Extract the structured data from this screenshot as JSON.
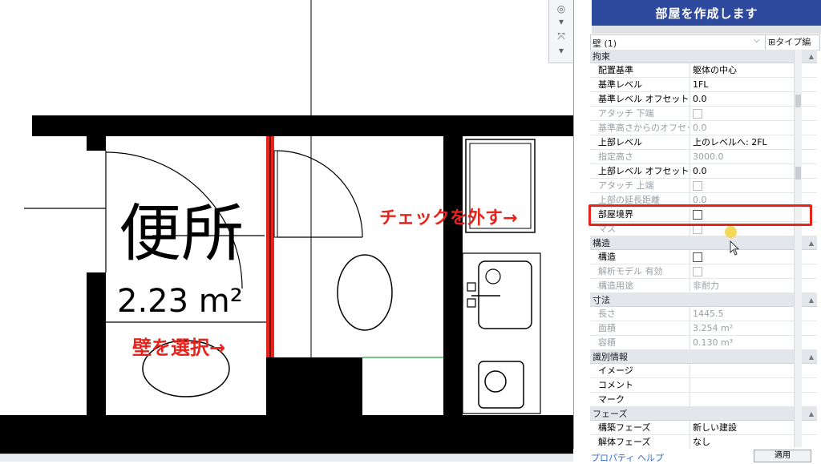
{
  "room": {
    "name": "便所",
    "area": "2.23 m²"
  },
  "annotations": {
    "select_wall": "壁を選択→",
    "uncheck": "チェックを外す→"
  },
  "panel": {
    "banner": "部屋を作成します",
    "type_selector": "壁 (1)",
    "edit_type": "タイプ編集",
    "sections": {
      "constraints": "拘束",
      "structure": "構造",
      "dimensions": "寸法",
      "identity": "識別情報",
      "phasing": "フェーズ"
    },
    "rows": {
      "location_line": {
        "k": "配置基準",
        "v": "躯体の中心"
      },
      "base_level": {
        "k": "基準レベル",
        "v": "1FL"
      },
      "base_offset": {
        "k": "基準レベル オフセット",
        "v": "0.0"
      },
      "attach_bottom": {
        "k": "アタッチ 下端"
      },
      "base_from_offset": {
        "k": "基準高さからのオフセット",
        "v": "0.0"
      },
      "top_level": {
        "k": "上部レベル",
        "v": "上のレベルへ: 2FL"
      },
      "unconnected_height": {
        "k": "指定高さ",
        "v": "3000.0"
      },
      "top_offset": {
        "k": "上部レベル オフセット",
        "v": "0.0"
      },
      "attach_top": {
        "k": "アタッチ 上端"
      },
      "top_extension": {
        "k": "上部の延長距離",
        "v": "0.0"
      },
      "room_bounding": {
        "k": "部屋境界"
      },
      "mass": {
        "k": "マス"
      },
      "structural": {
        "k": "構造"
      },
      "analytical_model": {
        "k": "解析モデル 有効"
      },
      "structural_usage": {
        "k": "構造用途",
        "v": "非耐力"
      },
      "length": {
        "k": "長さ",
        "v": "1445.5"
      },
      "area": {
        "k": "面積",
        "v": "3.254 m²"
      },
      "volume": {
        "k": "容積",
        "v": "0.130 m³"
      },
      "image": {
        "k": "イメージ"
      },
      "comments": {
        "k": "コメント"
      },
      "mark": {
        "k": "マーク"
      },
      "phase_created": {
        "k": "構築フェーズ",
        "v": "新しい建設"
      },
      "phase_demolished": {
        "k": "解体フェーズ",
        "v": "なし"
      }
    },
    "properties_help": "プロパティ ヘルプ",
    "apply": "適用"
  },
  "colors": {
    "banner": "#2e4a9e",
    "highlight": "#e8231b",
    "selected_wall": "#e8231b"
  }
}
